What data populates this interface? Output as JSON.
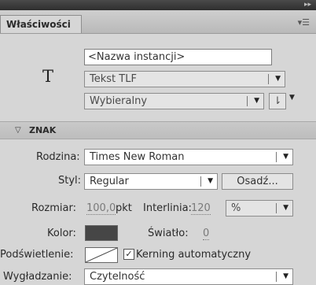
{
  "panel": {
    "tab_label": "Właściwości",
    "collapse_glyph": "▸▸",
    "menu_glyph": "▾☰"
  },
  "instance": {
    "icon_glyph": "T",
    "name_placeholder": "<Nazwa instancji>",
    "text_type": "Tekst TLF",
    "selectable": "Wybieralny",
    "para_glyph": "⇂"
  },
  "section": {
    "title": "ZNAK"
  },
  "character": {
    "family_label": "Rodzina:",
    "family_value": "Times New Roman",
    "style_label": "Styl:",
    "style_value": "Regular",
    "embed_label": "Osadź...",
    "size_label": "Rozmiar:",
    "size_value": "100,0",
    "size_unit": "pkt",
    "leading_label": "Interlinia:",
    "leading_value": "120",
    "leading_unit": "%",
    "color_label": "Kolor:",
    "color_value": "#464646",
    "tracking_label": "Światło:",
    "tracking_value": "0",
    "highlight_label": "Podświetlenie:",
    "kerning_label": "Kerning automatyczny",
    "kerning_checked": true,
    "antialias_label": "Wygładzanie:",
    "antialias_value": "Czytelność"
  }
}
